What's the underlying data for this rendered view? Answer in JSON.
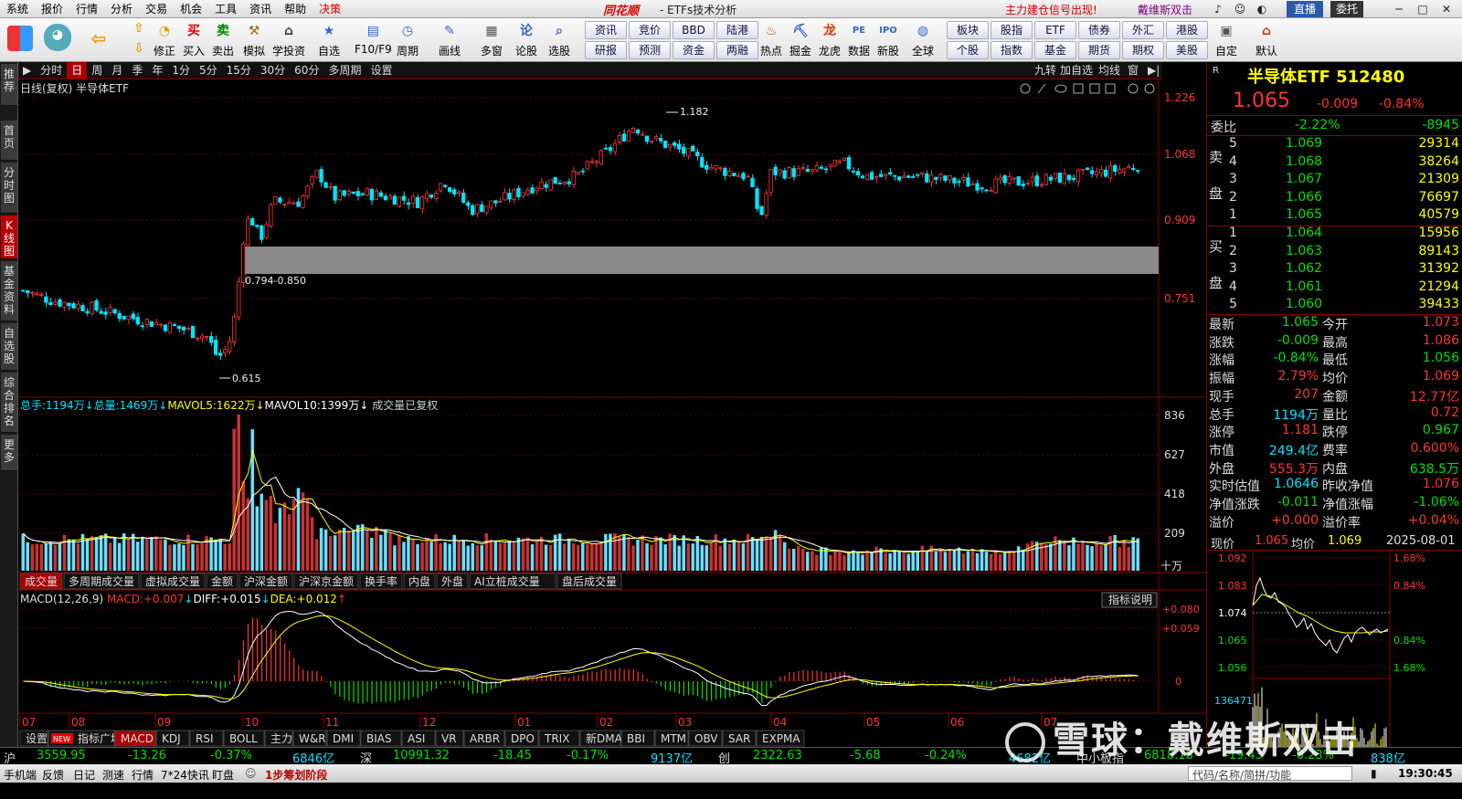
{
  "menu": {
    "items": [
      "系统",
      "报价",
      "行情",
      "分析",
      "交易",
      "机会",
      "工具",
      "资讯",
      "帮助",
      "决策"
    ],
    "logo": "同花顺",
    "app_title": "- ETFs技术分析",
    "alert": "主力建仓信号出现!",
    "alert2": "戴维斯双击",
    "live_btn": "直播",
    "order_btn": "委托"
  },
  "toolbar": {
    "buttons": [
      "修正",
      "买入",
      "卖出",
      "模拟",
      "学投资",
      "自选",
      "F10/F9",
      "周期",
      "画线",
      "多窗",
      "论股",
      "选股",
      "热点",
      "掘金",
      "龙虎",
      "数据",
      "新股",
      "全球",
      "自定",
      "默认"
    ],
    "small": [
      [
        "资讯",
        "竞价",
        "BBD",
        "陆港"
      ],
      [
        "研报",
        "预测",
        "资金",
        "两融"
      ],
      [
        "板块",
        "股指",
        "ETF",
        "债券",
        "外汇",
        "港股"
      ],
      [
        "个股",
        "指数",
        "基金",
        "期货",
        "期权",
        "美股"
      ]
    ]
  },
  "left_tabs": [
    "推荐",
    "首页",
    "分时图",
    "K线图",
    "基金资料",
    "自选股",
    "综合排名",
    "更多"
  ],
  "period_bar": {
    "items": [
      "分时",
      "日",
      "周",
      "月",
      "季",
      "年",
      "1分",
      "5分",
      "15分",
      "30分",
      "60分",
      "多周期",
      "设置"
    ],
    "active": "日",
    "right": [
      "九转",
      "加自选",
      "均线",
      "窗"
    ]
  },
  "chart_header": "日线(复权)  半导体ETF",
  "price_axis": [
    "1.226",
    "1.068",
    "0.909",
    "0.751"
  ],
  "annotations": {
    "high": "1.182",
    "low": "0.615",
    "gap": "0.794-0.850"
  },
  "volume_header": {
    "total_hand_label": "总手:",
    "total_hand": "1194万",
    "total_label": "总量:",
    "total": "1469万",
    "mavol5_label": "MAVOL5:",
    "mavol5": "1622万",
    "mavol10_label": "MAVOL10:",
    "mavol10": "1399万",
    "note": "成交量已复权"
  },
  "volume_axis": [
    "836",
    "627",
    "418",
    "209"
  ],
  "volume_unit": "十万",
  "vol_tabs": [
    "成交量",
    "多周期成交量",
    "虚拟成交量",
    "金额",
    "沪深金额",
    "沪深京金额",
    "换手率",
    "内盘",
    "外盘",
    "AI立桩成交量",
    "盘后成交量"
  ],
  "macd_header": {
    "name": "MACD(12,26,9)",
    "macd_label": "MACD:",
    "macd": "+0.007",
    "diff_label": "DIFF:",
    "diff": "+0.015",
    "dea_label": "DEA:",
    "dea": "+0.012",
    "help": "指标说明"
  },
  "macd_axis": [
    "+0.080",
    "+0.059",
    "0"
  ],
  "months": [
    "07",
    "08",
    "09",
    "10",
    "11",
    "12",
    "01",
    "02",
    "03",
    "04",
    "05",
    "06",
    "07"
  ],
  "indicator_tabs": [
    "设置",
    "指标广场",
    "MACD",
    "KDJ",
    "RSI",
    "BOLL",
    "主力",
    "W&R",
    "DMI",
    "BIAS",
    "ASI",
    "VR",
    "ARBR",
    "DPO",
    "TRIX",
    "新DMA",
    "BBI",
    "MTM",
    "OBV",
    "SAR",
    "EXPMA"
  ],
  "quote": {
    "r": "R",
    "name": "半导体ETF 512480",
    "price": "1.065",
    "change": "-0.009",
    "pct": "-0.84%",
    "wb_label": "委比",
    "wb": "-2.22%",
    "wc": "-8945",
    "sell_label": [
      "卖",
      "盘"
    ],
    "buy_label": [
      "买",
      "盘"
    ],
    "asks": [
      [
        "5",
        "1.069",
        "29314"
      ],
      [
        "4",
        "1.068",
        "38264"
      ],
      [
        "3",
        "1.067",
        "21309"
      ],
      [
        "2",
        "1.066",
        "76697"
      ],
      [
        "1",
        "1.065",
        "40579"
      ]
    ],
    "bids": [
      [
        "1",
        "1.064",
        "15956"
      ],
      [
        "2",
        "1.063",
        "89143"
      ],
      [
        "3",
        "1.062",
        "31392"
      ],
      [
        "4",
        "1.061",
        "21294"
      ],
      [
        "5",
        "1.060",
        "39433"
      ]
    ],
    "stats": [
      [
        "最新",
        "1.065",
        "今开",
        "1.073"
      ],
      [
        "涨跌",
        "-0.009",
        "最高",
        "1.086"
      ],
      [
        "涨幅",
        "-0.84%",
        "最低",
        "1.056"
      ],
      [
        "振幅",
        "2.79%",
        "均价",
        "1.069"
      ],
      [
        "现手",
        "207",
        "金额",
        "12.77亿"
      ],
      [
        "总手",
        "1194万",
        "量比",
        "0.72"
      ],
      [
        "涨停",
        "1.181",
        "跌停",
        "0.967"
      ],
      [
        "市值",
        "249.4亿",
        "费率",
        "0.600%"
      ],
      [
        "外盘",
        "555.3万",
        "内盘",
        "638.5万"
      ],
      [
        "实时估值",
        "1.0646",
        "昨收净值",
        "1.076"
      ],
      [
        "净值涨跌",
        "-0.011",
        "净值涨幅",
        "-1.06%"
      ],
      [
        "溢价",
        "+0.000",
        "溢价率",
        "+0.04%"
      ]
    ]
  },
  "tick": {
    "now_label": "现价",
    "now": "1.065",
    "avg_label": "均价",
    "avg": "1.069",
    "date": "2025-08-01",
    "left_axis": [
      "1.092",
      "1.083",
      "1.074",
      "1.065",
      "1.056"
    ],
    "right_axis": [
      "1.68%",
      "0.84%",
      "0.84%",
      "1.68%"
    ],
    "vol_label": "136471"
  },
  "index_bar": {
    "sh_label": "沪",
    "sh": "3559.95",
    "sh_chg": "-13.26",
    "sh_pct": "-0.37%",
    "sh_amt": "6846亿",
    "sz_label": "深",
    "sz": "10991.32",
    "sz_chg": "-18.45",
    "sz_pct": "-0.17%",
    "sz_amt": "9137亿",
    "cy_label": "创",
    "cy": "2322.63",
    "cy_chg": "-5.68",
    "cy_pct": "-0.24%",
    "cy_amt": "4682亿",
    "zx_label": "中小板指",
    "zx": "6818.18",
    "zx_chg": "-19.43",
    "zx_pct": "-0.23%",
    "zx_amt": "838亿"
  },
  "status": {
    "items": [
      "手机端",
      "反馈",
      "日记",
      "测速",
      "行情",
      "7*24快讯",
      "盯盘"
    ],
    "msg": "1步筹划阶段",
    "search": "代码/名称/简拼/功能",
    "time": "19:30:45"
  },
  "watermark": "雪球：戴维斯双击"
}
